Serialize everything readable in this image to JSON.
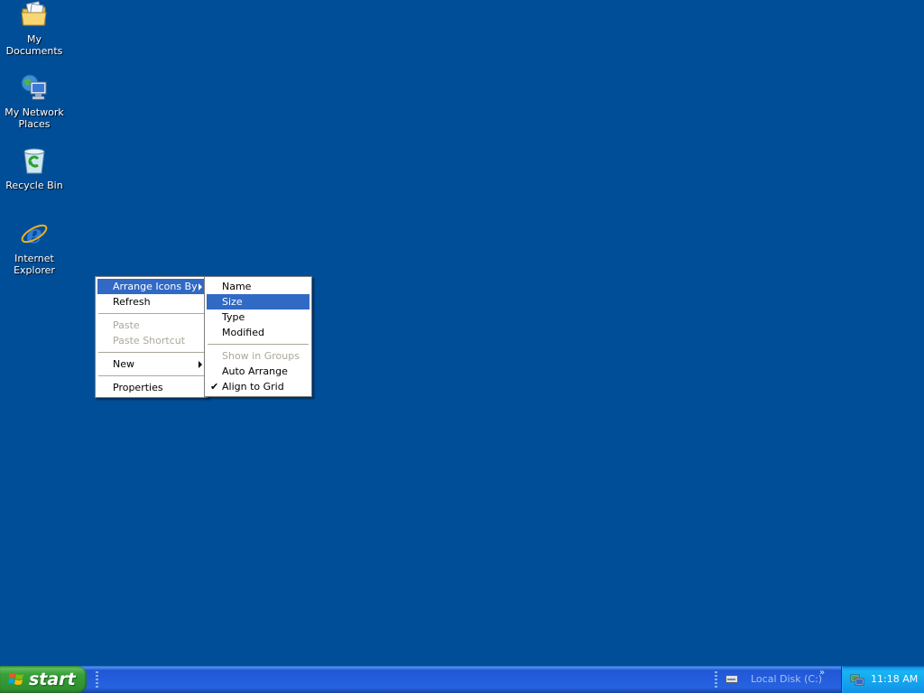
{
  "desktop": {
    "background_color": "#004e98",
    "icons": [
      {
        "label": "My Documents",
        "icon": "my-documents-icon"
      },
      {
        "label": "My Network Places",
        "icon": "network-places-icon"
      },
      {
        "label": "Recycle Bin",
        "icon": "recycle-bin-icon"
      },
      {
        "label": "Internet Explorer",
        "icon": "internet-explorer-icon"
      }
    ]
  },
  "context_menu": {
    "items": [
      {
        "label": "Arrange Icons By",
        "highlighted": true,
        "submenu": true
      },
      {
        "label": "Refresh"
      },
      {
        "label": "Paste",
        "disabled": true
      },
      {
        "label": "Paste Shortcut",
        "disabled": true
      },
      {
        "label": "New",
        "submenu": true
      },
      {
        "label": "Properties"
      }
    ]
  },
  "arrange_submenu": {
    "items": [
      {
        "label": "Name"
      },
      {
        "label": "Size",
        "highlighted": true
      },
      {
        "label": "Type"
      },
      {
        "label": "Modified"
      },
      {
        "label": "Show in Groups",
        "disabled": true
      },
      {
        "label": "Auto Arrange"
      },
      {
        "label": "Align to Grid",
        "checked": true
      }
    ]
  },
  "taskbar": {
    "start_label": "start",
    "address_toolbar_label": "Local Disk (C:)",
    "chevron": "»",
    "clock": "11:18 AM"
  },
  "colors": {
    "highlight": "#316ac5",
    "taskbar": "#2663e0",
    "start_green": "#38a138",
    "tray": "#139beb"
  }
}
